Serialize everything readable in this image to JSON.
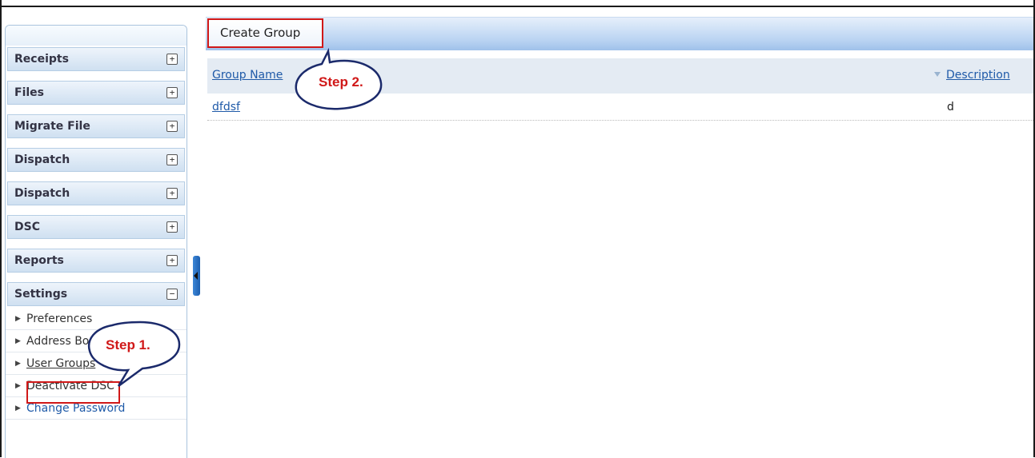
{
  "sidebar": {
    "sections": [
      {
        "label": "Receipts",
        "toggle": "+"
      },
      {
        "label": "Files",
        "toggle": "+"
      },
      {
        "label": "Migrate File",
        "toggle": "+"
      },
      {
        "label": "Dispatch",
        "toggle": "+"
      },
      {
        "label": "Dispatch",
        "toggle": "+"
      },
      {
        "label": "DSC",
        "toggle": "+"
      },
      {
        "label": "Reports",
        "toggle": "+"
      },
      {
        "label": "Settings",
        "toggle": "−"
      }
    ],
    "settings_items": [
      {
        "label": "Preferences"
      },
      {
        "label": "Address Book"
      },
      {
        "label": "User Groups"
      },
      {
        "label": "Deactivate DSC"
      },
      {
        "label": "Change Password"
      }
    ]
  },
  "toolbar": {
    "create_group_label": "Create Group"
  },
  "table": {
    "columns": [
      "Group Name",
      "Description"
    ],
    "rows": [
      {
        "group_name": "dfdsf",
        "description": "d"
      }
    ]
  },
  "callouts": {
    "step1": "Step 1.",
    "step2": "Step 2."
  },
  "colors": {
    "highlight": "#d01818",
    "link": "#1f5aa8",
    "header_bar": "#b9d3f2"
  },
  "icons": {
    "expand": "plus-box-icon",
    "collapse": "minus-box-icon",
    "submenu_arrow": "triangle-right-icon",
    "sort": "sort-down-icon"
  }
}
